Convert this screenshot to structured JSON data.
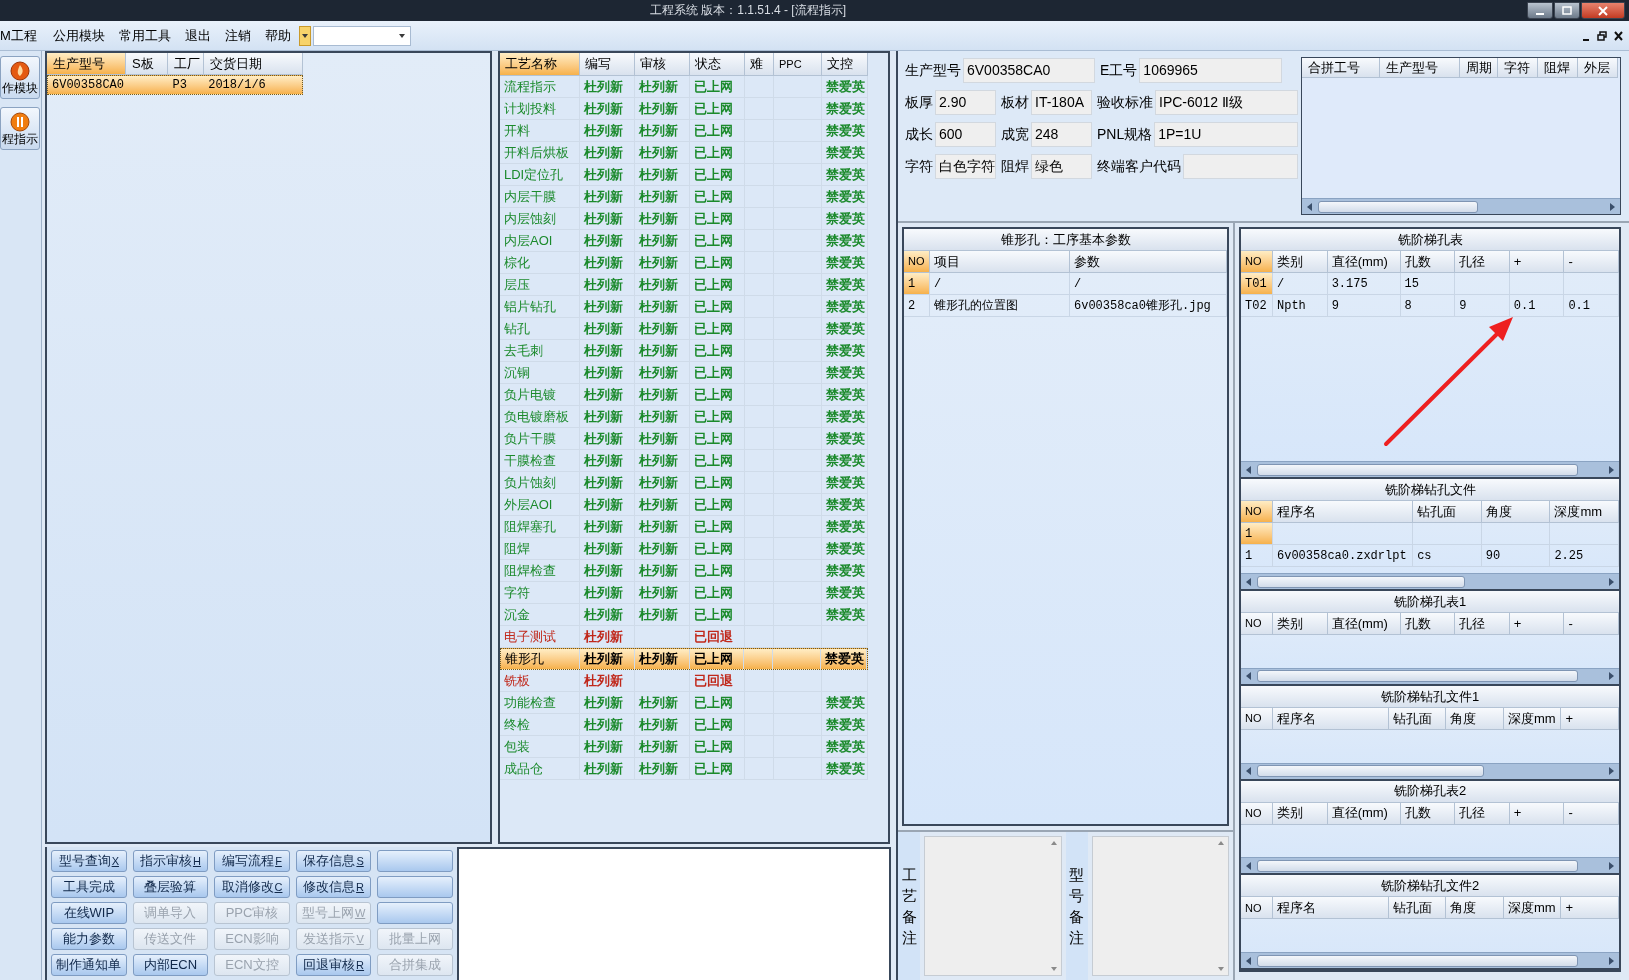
{
  "window": {
    "title": "工程系统   版本：1.1.51.4 - [流程指示]"
  },
  "menu": [
    "M工程",
    "公用模块",
    "常用工具",
    "退出",
    "注销",
    "帮助"
  ],
  "nav": [
    {
      "label": "作模块"
    },
    {
      "label": "程指示"
    }
  ],
  "orders": {
    "focused": true,
    "columns": [
      "生产型号",
      "S板",
      "工厂",
      "交货日期"
    ],
    "rows": [
      {
        "cells": [
          "6V00358CA0",
          null,
          "P3",
          "2018/1/6"
        ],
        "selected": true
      }
    ]
  },
  "process": {
    "focused": true,
    "columns": [
      "工艺名称",
      "编写",
      "审核",
      "状态",
      "难",
      "PPC",
      "文控"
    ],
    "rows": [
      {
        "name": "流程指示",
        "writer": "杜列新",
        "reviewer": "杜列新",
        "status": "已上网",
        "control": "禁爱英",
        "returned": false,
        "selected": false
      },
      {
        "name": "计划投料",
        "writer": "杜列新",
        "reviewer": "杜列新",
        "status": "已上网",
        "control": "禁爱英",
        "returned": false,
        "selected": false
      },
      {
        "name": "开料",
        "writer": "杜列新",
        "reviewer": "杜列新",
        "status": "已上网",
        "control": "禁爱英",
        "returned": false,
        "selected": false
      },
      {
        "name": "开料后烘板",
        "writer": "杜列新",
        "reviewer": "杜列新",
        "status": "已上网",
        "control": "禁爱英",
        "returned": false,
        "selected": false
      },
      {
        "name": "LDI定位孔",
        "writer": "杜列新",
        "reviewer": "杜列新",
        "status": "已上网",
        "control": "禁爱英",
        "returned": false,
        "selected": false
      },
      {
        "name": "内层干膜",
        "writer": "杜列新",
        "reviewer": "杜列新",
        "status": "已上网",
        "control": "禁爱英",
        "returned": false,
        "selected": false
      },
      {
        "name": "内层蚀刻",
        "writer": "杜列新",
        "reviewer": "杜列新",
        "status": "已上网",
        "control": "禁爱英",
        "returned": false,
        "selected": false
      },
      {
        "name": "内层AOI",
        "writer": "杜列新",
        "reviewer": "杜列新",
        "status": "已上网",
        "control": "禁爱英",
        "returned": false,
        "selected": false
      },
      {
        "name": "棕化",
        "writer": "杜列新",
        "reviewer": "杜列新",
        "status": "已上网",
        "control": "禁爱英",
        "returned": false,
        "selected": false
      },
      {
        "name": "层压",
        "writer": "杜列新",
        "reviewer": "杜列新",
        "status": "已上网",
        "control": "禁爱英",
        "returned": false,
        "selected": false
      },
      {
        "name": "铝片钻孔",
        "writer": "杜列新",
        "reviewer": "杜列新",
        "status": "已上网",
        "control": "禁爱英",
        "returned": false,
        "selected": false
      },
      {
        "name": "钻孔",
        "writer": "杜列新",
        "reviewer": "杜列新",
        "status": "已上网",
        "control": "禁爱英",
        "returned": false,
        "selected": false
      },
      {
        "name": "去毛刺",
        "writer": "杜列新",
        "reviewer": "杜列新",
        "status": "已上网",
        "control": "禁爱英",
        "returned": false,
        "selected": false
      },
      {
        "name": "沉铜",
        "writer": "杜列新",
        "reviewer": "杜列新",
        "status": "已上网",
        "control": "禁爱英",
        "returned": false,
        "selected": false
      },
      {
        "name": "负片电镀",
        "writer": "杜列新",
        "reviewer": "杜列新",
        "status": "已上网",
        "control": "禁爱英",
        "returned": false,
        "selected": false
      },
      {
        "name": "负电镀磨板",
        "writer": "杜列新",
        "reviewer": "杜列新",
        "status": "已上网",
        "control": "禁爱英",
        "returned": false,
        "selected": false
      },
      {
        "name": "负片干膜",
        "writer": "杜列新",
        "reviewer": "杜列新",
        "status": "已上网",
        "control": "禁爱英",
        "returned": false,
        "selected": false
      },
      {
        "name": "干膜检查",
        "writer": "杜列新",
        "reviewer": "杜列新",
        "status": "已上网",
        "control": "禁爱英",
        "returned": false,
        "selected": false
      },
      {
        "name": "负片蚀刻",
        "writer": "杜列新",
        "reviewer": "杜列新",
        "status": "已上网",
        "control": "禁爱英",
        "returned": false,
        "selected": false
      },
      {
        "name": "外层AOI",
        "writer": "杜列新",
        "reviewer": "杜列新",
        "status": "已上网",
        "control": "禁爱英",
        "returned": false,
        "selected": false
      },
      {
        "name": "阻焊塞孔",
        "writer": "杜列新",
        "reviewer": "杜列新",
        "status": "已上网",
        "control": "禁爱英",
        "returned": false,
        "selected": false
      },
      {
        "name": "阻焊",
        "writer": "杜列新",
        "reviewer": "杜列新",
        "status": "已上网",
        "control": "禁爱英",
        "returned": false,
        "selected": false
      },
      {
        "name": "阻焊检查",
        "writer": "杜列新",
        "reviewer": "杜列新",
        "status": "已上网",
        "control": "禁爱英",
        "returned": false,
        "selected": false
      },
      {
        "name": "字符",
        "writer": "杜列新",
        "reviewer": "杜列新",
        "status": "已上网",
        "control": "禁爱英",
        "returned": false,
        "selected": false
      },
      {
        "name": "沉金",
        "writer": "杜列新",
        "reviewer": "杜列新",
        "status": "已上网",
        "control": "禁爱英",
        "returned": false,
        "selected": false
      },
      {
        "name": "电子测试",
        "writer": "杜列新",
        "status": "已回退",
        "returned": true,
        "selected": false
      },
      {
        "name": "锥形孔",
        "writer": "杜列新",
        "reviewer": "杜列新",
        "status": "已上网",
        "control": "禁爱英",
        "returned": false,
        "selected": true
      },
      {
        "name": "铣板",
        "writer": "杜列新",
        "status": "已回退",
        "returned": true,
        "selected": false
      },
      {
        "name": "功能检查",
        "writer": "杜列新",
        "reviewer": "杜列新",
        "status": "已上网",
        "control": "禁爱英",
        "returned": false,
        "selected": false
      },
      {
        "name": "终检",
        "writer": "杜列新",
        "reviewer": "杜列新",
        "status": "已上网",
        "control": "禁爱英",
        "returned": false,
        "selected": false
      },
      {
        "name": "包装",
        "writer": "杜列新",
        "reviewer": "杜列新",
        "status": "已上网",
        "control": "禁爱英",
        "returned": false,
        "selected": false
      },
      {
        "name": "成品仓",
        "writer": "杜列新",
        "reviewer": "杜列新",
        "status": "已上网",
        "control": "禁爱英",
        "returned": false,
        "selected": false
      }
    ]
  },
  "buttons": [
    {
      "label": "型号查询",
      "hotkey": "X",
      "disabled": false
    },
    {
      "label": "指示审核",
      "hotkey": "H",
      "disabled": false
    },
    {
      "label": "编写流程",
      "hotkey": "F",
      "disabled": false
    },
    {
      "label": "保存信息",
      "hotkey": "S",
      "disabled": false
    },
    {
      "disabled": false
    },
    {
      "label": "工具完成",
      "disabled": false
    },
    {
      "label": "叠层验算",
      "disabled": false
    },
    {
      "label": "取消修改",
      "hotkey": "C",
      "disabled": false
    },
    {
      "label": "修改信息",
      "hotkey": "R",
      "disabled": false
    },
    {
      "disabled": false
    },
    {
      "label": "在线WIP",
      "disabled": false
    },
    {
      "label": "调单导入",
      "disabled": true
    },
    {
      "label": "PPC审核",
      "disabled": true
    },
    {
      "label": "型号上网",
      "hotkey": "W",
      "disabled": true
    },
    {
      "disabled": false
    },
    {
      "label": "能力参数",
      "disabled": false
    },
    {
      "label": "传送文件",
      "disabled": true
    },
    {
      "label": "ECN影响",
      "disabled": true
    },
    {
      "label": "发送指示",
      "hotkey": "V",
      "disabled": true
    },
    {
      "label": "批量上网",
      "disabled": true
    },
    {
      "label": "制作通知单",
      "disabled": false
    },
    {
      "label": "内部ECN",
      "disabled": false
    },
    {
      "label": "ECN文控",
      "disabled": true
    },
    {
      "label": "回退审核",
      "hotkey": "R",
      "disabled": false
    },
    {
      "label": "合拼集成",
      "disabled": true
    }
  ],
  "form": [
    [
      {
        "label": "生产型号",
        "value": "6V00358CA0"
      },
      {
        "label": "E工号",
        "value": "1069965"
      }
    ],
    [
      {
        "label": "板厚",
        "value": "2.90"
      },
      {
        "label": "板材",
        "value": "IT-180A"
      },
      {
        "label": "验收标准",
        "value": "IPC-6012 Ⅱ级"
      }
    ],
    [
      {
        "label": "成长",
        "value": "600"
      },
      {
        "label": "成宽",
        "value": "248"
      },
      {
        "label": "PNL规格",
        "value": "1P=1U"
      }
    ],
    [
      {
        "label": "字符",
        "value": "白色字符"
      },
      {
        "label": "阻焊",
        "value": "绿色"
      },
      {
        "label": "终端客户代码"
      }
    ]
  ],
  "merge_table": {
    "columns": [
      "合拼工号",
      "生产型号",
      "周期",
      "字符",
      "阻焊",
      "外层"
    ]
  },
  "params": {
    "title": "锥形孔：工序基本参数",
    "focused": true,
    "columns": [
      "NO",
      "项目",
      "参数"
    ],
    "rows": [
      {
        "cells": [
          "1",
          "/",
          "/"
        ],
        "selected": true
      },
      {
        "cells": [
          "2",
          "锥形孔的位置图",
          "6v00358ca0锥形孔.jpg"
        ],
        "selected": false
      }
    ]
  },
  "remarks": [
    {
      "label": "工艺备注"
    },
    {
      "label": "型号备注"
    }
  ],
  "right_tables": [
    {
      "title": "铣阶梯孔表",
      "kind": "holes",
      "focused": true,
      "columns": [
        "NO",
        "类别",
        "直径(mm)",
        "孔数",
        "孔径",
        "+",
        "-"
      ],
      "rows": [
        {
          "cells": [
            "T01",
            "/",
            "3.175",
            "15"
          ],
          "selected": true
        },
        {
          "cells": [
            "T02",
            "Npth",
            "9",
            "8",
            "9",
            "0.1",
            "0.1"
          ],
          "selected": false
        }
      ]
    },
    {
      "title": "铣阶梯钻孔文件",
      "kind": "drill",
      "focused": true,
      "columns": [
        "NO",
        "程序名",
        "钻孔面",
        "角度",
        "深度mm"
      ],
      "rows": [
        {
          "cells": [
            "1"
          ],
          "selected": true
        },
        {
          "cells": [
            "1",
            "6v00358ca0.zxdrlpt",
            "cs",
            "90",
            "2.25"
          ],
          "selected": false
        }
      ]
    },
    {
      "title": "铣阶梯孔表1",
      "kind": "holes",
      "focused": false,
      "columns": [
        "NO",
        "类别",
        "直径(mm)",
        "孔数",
        "孔径",
        "+",
        "-"
      ]
    },
    {
      "title": "铣阶梯钻孔文件1",
      "kind": "drill",
      "focused": false,
      "columns": [
        "NO",
        "程序名",
        "钻孔面",
        "角度",
        "深度mm",
        "+"
      ]
    },
    {
      "title": "铣阶梯孔表2",
      "kind": "holes",
      "focused": false,
      "columns": [
        "NO",
        "类别",
        "直径(mm)",
        "孔数",
        "孔径",
        "+",
        "-"
      ]
    },
    {
      "title": "铣阶梯钻孔文件2",
      "kind": "drill",
      "focused": false,
      "columns": [
        "NO",
        "程序名",
        "钻孔面",
        "角度",
        "深度mm",
        "+"
      ]
    }
  ]
}
